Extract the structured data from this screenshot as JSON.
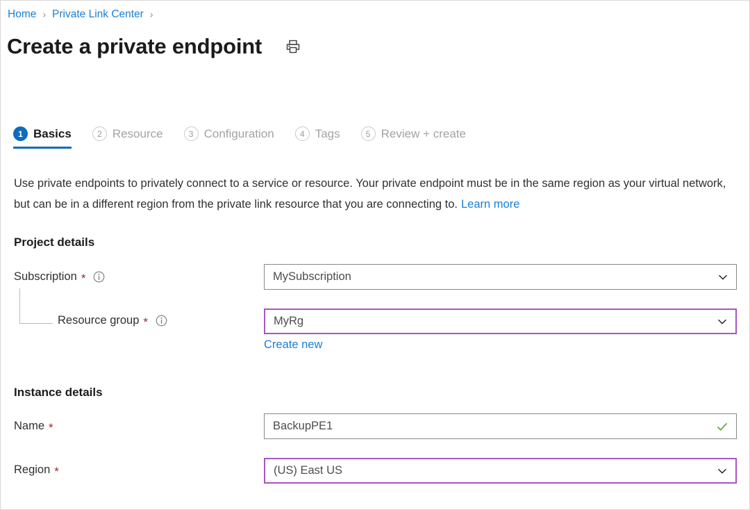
{
  "breadcrumb": {
    "items": [
      {
        "label": "Home"
      },
      {
        "label": "Private Link Center"
      }
    ],
    "separator": "›"
  },
  "header": {
    "title": "Create a private endpoint",
    "print_icon": "printer-icon"
  },
  "tabs": [
    {
      "number": "1",
      "label": "Basics",
      "active": true
    },
    {
      "number": "2",
      "label": "Resource",
      "active": false
    },
    {
      "number": "3",
      "label": "Configuration",
      "active": false
    },
    {
      "number": "4",
      "label": "Tags",
      "active": false
    },
    {
      "number": "5",
      "label": "Review + create",
      "active": false
    }
  ],
  "description": {
    "text": "Use private endpoints to privately connect to a service or resource. Your private endpoint must be in the same region as your virtual network, but can be in a different region from the private link resource that you are connecting to.",
    "link_label": "Learn more"
  },
  "sections": {
    "project_details": {
      "heading": "Project details",
      "fields": {
        "subscription": {
          "label": "Subscription",
          "required_marker": "*",
          "info_icon": "info-icon",
          "value": "MySubscription",
          "control": "dropdown",
          "state": "normal"
        },
        "resource_group": {
          "label": "Resource group",
          "required_marker": "*",
          "info_icon": "info-icon",
          "value": "MyRg",
          "control": "dropdown",
          "state": "focused",
          "create_new_label": "Create new"
        }
      }
    },
    "instance_details": {
      "heading": "Instance details",
      "fields": {
        "name": {
          "label": "Name",
          "required_marker": "*",
          "value": "BackupPE1",
          "control": "textbox",
          "state": "valid",
          "validation_icon": "check-icon"
        },
        "region": {
          "label": "Region",
          "required_marker": "*",
          "value": "(US) East US",
          "control": "dropdown",
          "state": "focused"
        }
      }
    }
  },
  "colors": {
    "accent_blue": "#0f6cbd",
    "link_blue": "#1a7fd4",
    "required_red": "#a4262c",
    "focus_purple": "#a855c0",
    "valid_green": "#5aaa3c",
    "border_gray": "#8a8886"
  }
}
